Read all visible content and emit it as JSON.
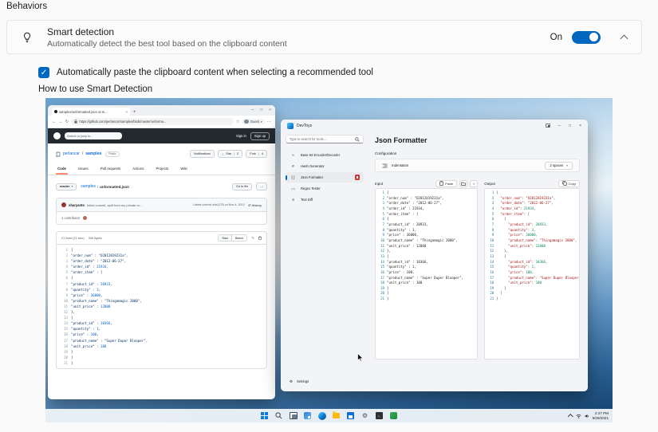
{
  "section": {
    "title": "Behaviors"
  },
  "smart_detection": {
    "title": "Smart detection",
    "subtitle": "Automatically detect the best tool based on the clipboard content",
    "toggle_state": "On",
    "checkbox_label": "Automatically paste the clipboard content when selecting a recommended tool",
    "howto_label": "How to use Smart Detection",
    "accent_color": "#0067c0"
  },
  "icons": {
    "check": "✓",
    "close": "×",
    "minimize": "─",
    "maximize": "□",
    "back": "←",
    "forward": "→",
    "refresh": "↻",
    "star": "☆",
    "menu": "⋯",
    "ellipsis": "⋯",
    "caret_down": "▾",
    "new_tab": "+",
    "history": "↺",
    "edit": "✎",
    "gear": "⚙",
    "terminal": ">_",
    "slash": "/"
  },
  "shot": {
    "browser": {
      "tab_title": "samples/unformatted.json at m...",
      "url": "https://github.com/perlancar/samples/blob/master/unforma...",
      "profile_label": "Guest",
      "github": {
        "search_placeholder": "Search or jump to...",
        "sign_in": "Sign in",
        "sign_up": "Sign up",
        "owner": "perlancar",
        "repo": "samples",
        "visibility": "Public",
        "notifications_label": "Notifications",
        "star_label": "Star",
        "star_count": "2",
        "fork_label": "Fork",
        "fork_count": "4",
        "tabs": [
          "Code",
          "Issues",
          "Pull requests",
          "Actions",
          "Projects",
          "Wiki"
        ],
        "branch": "master",
        "breadcrumb_repo": "samples",
        "breadcrumb_file": "unformatted.json",
        "go_to_file_label": "Go to file",
        "commit_author": "sharyanto",
        "commit_message": "Initial commit, split from my private m…",
        "latest_commit_label": "Latest commit eda1276 on Nov 4, 2013",
        "history_label": "History",
        "contributors_label": "1 contributor",
        "file_meta": "21 lines (21 sloc)",
        "file_size": "336 Bytes",
        "raw_label": "Raw",
        "blame_label": "Blame",
        "code_lines": [
          "{",
          "\"order_num\" : \"O2012019231a\",",
          "\"order_date\" : \"2012-06-27\",",
          "\"order_id\" : 21934,",
          "\"order_item\" : [",
          "{",
          "\"product_id\" : 20933,",
          "\"quantity\" : 3,",
          "\"price\" : 36000,",
          "\"product_name\" : \"Thingamagic 2000\",",
          "\"unit_price\" : 12000",
          "},",
          "{",
          "\"product_id\" : 10366,",
          "\"quantity\" : 1,",
          "\"price\" : 100,",
          "\"product_name\" : \"Super Duper Blooper\",",
          "\"unit_price\" : 100",
          "}",
          "]",
          "}"
        ]
      }
    },
    "devtoys": {
      "app_title": "DevToys",
      "search_placeholder": "Type to search for tools...",
      "tools": [
        {
          "label": "Base 64 Encoder/Decoder",
          "glyph": "≈"
        },
        {
          "label": "Hash Generator",
          "glyph": "#"
        },
        {
          "label": "Json Formatter",
          "glyph": "{ }"
        },
        {
          "label": "Regex Tester",
          "glyph": "(.*)"
        },
        {
          "label": "Text Diff",
          "glyph": "≡"
        }
      ],
      "settings_label": "Settings",
      "page_title": "Json Formatter",
      "configuration_label": "Configuration",
      "indentation_label": "Indentation",
      "indentation_value": "2 spaces",
      "input_label": "Input",
      "paste_label": "Paste",
      "output_label": "Output",
      "copy_label": "Copy",
      "input_lines": [
        "{",
        "\"order_num\" : \"O2012019231a\",",
        "\"order_date\" : \"2012-06-27\",",
        "\"order_id\" : 21934,",
        "\"order_item\" : [",
        "{",
        "\"product_id\" : 20933,",
        "\"quantity\" : 3,",
        "\"price\" : 36000,",
        "\"product_name\" : \"Thingamagic 2000\",",
        "\"unit_price\" : 12000",
        "},",
        "{",
        "\"product_id\" : 10366,",
        "\"quantity\" : 1,",
        "\"price\" : 100,",
        "\"product_name\" : \"Super Duper Blooper\",",
        "\"unit_price\" : 100",
        "}",
        "]",
        "}"
      ],
      "output_lines": [
        "{",
        "  \"order_num\": \"O2012019231a\",",
        "  \"order_date\": \"2012-06-27\",",
        "  \"order_id\": 21934,",
        "  \"order_item\": [",
        "    {",
        "      \"product_id\": 20933,",
        "      \"quantity\": 3,",
        "      \"price\": 36000,",
        "      \"product_name\": \"Thingamagic 2000\",",
        "      \"unit_price\": 12000",
        "    },",
        "    {",
        "      \"product_id\": 10366,",
        "      \"quantity\": 1,",
        "      \"price\": 100,",
        "      \"product_name\": \"Super Duper Blooper\",",
        "      \"unit_price\": 100",
        "    }",
        "  ]",
        "}"
      ]
    },
    "taskbar": {
      "time": "2:47 PM",
      "date": "9/28/2021",
      "icons": [
        "start",
        "search",
        "task-view",
        "widgets",
        "edge",
        "file-explorer",
        "store",
        "settings",
        "terminal",
        "pinned-app"
      ]
    }
  }
}
